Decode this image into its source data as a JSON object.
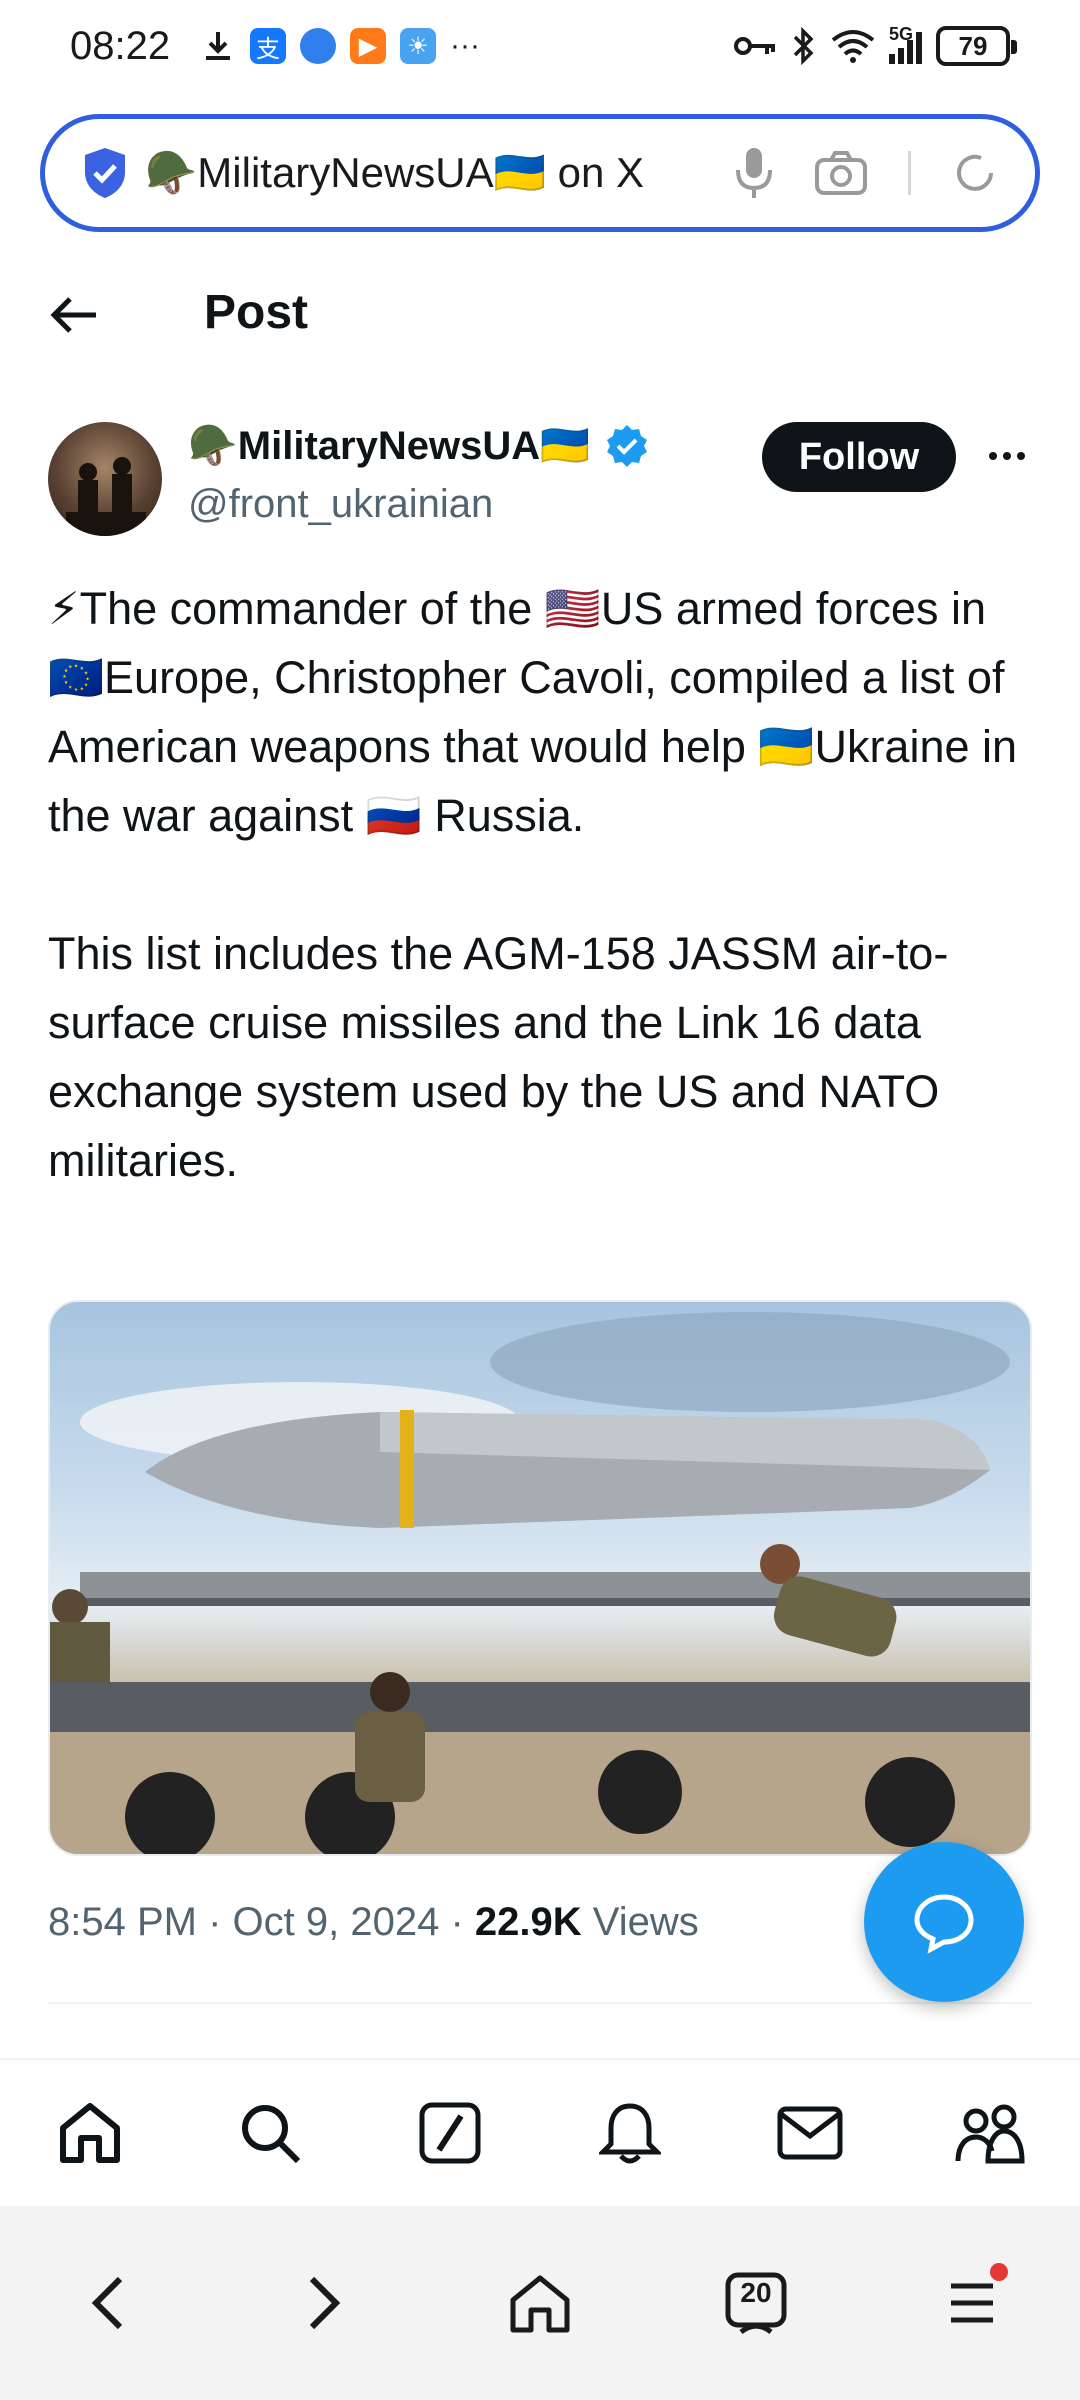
{
  "status_bar": {
    "time": "08:22",
    "network": "5G",
    "battery": "79"
  },
  "address_bar": {
    "text": "🪖MilitaryNewsUA🇺🇦 on X"
  },
  "header": {
    "title": "Post"
  },
  "author": {
    "name": "🪖MilitaryNewsUA🇺🇦",
    "handle": "@front_ukrainian",
    "follow_label": "Follow"
  },
  "tweet": {
    "text": "⚡The commander of the 🇺🇸US armed forces in 🇪🇺Europe, Christopher Cavoli, compiled a list of American weapons that would help 🇺🇦Ukraine in the war against 🇷🇺 Russia.\n\nThis list includes the AGM-158 JASSM air-to-surface cruise missiles and the Link 16 data exchange system used by the US and NATO militaries."
  },
  "meta": {
    "time": "8:54 PM",
    "date": "Oct 9, 2024",
    "views_count": "22.9K",
    "views_label": "Views"
  },
  "browser_bar": {
    "tab_count": "20"
  },
  "colors": {
    "accent": "#1d9bf0",
    "address_border": "#2f5fe0",
    "text_primary": "#0f1419",
    "text_secondary": "#536471"
  },
  "icons": {
    "status_left": [
      "download-icon",
      "alipay-icon",
      "app-icon",
      "video-icon",
      "weather-icon",
      "more-dots-icon"
    ],
    "status_right": [
      "key-icon",
      "bluetooth-icon",
      "wifi-icon",
      "signal-icon",
      "battery-icon"
    ],
    "x_nav": [
      "home-icon",
      "search-icon",
      "grok-icon",
      "notifications-icon",
      "messages-icon",
      "communities-icon"
    ],
    "browser_nav": [
      "back-icon",
      "forward-icon",
      "home-icon",
      "tabs-icon",
      "menu-icon"
    ]
  }
}
